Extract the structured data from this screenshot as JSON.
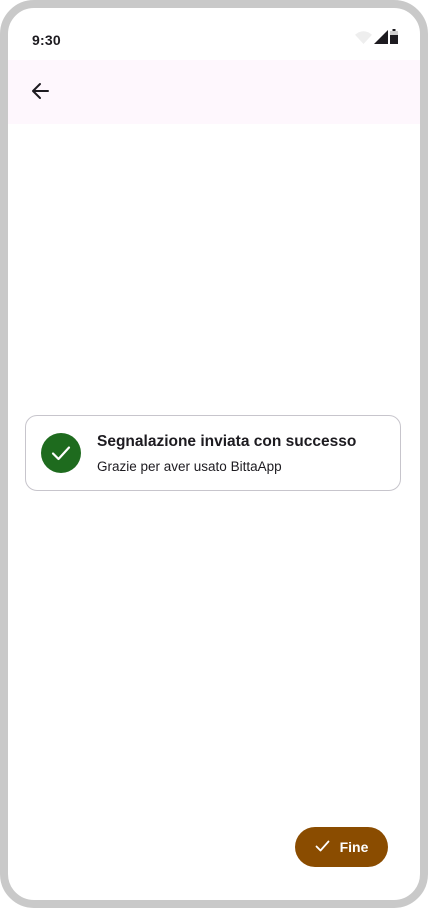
{
  "status_bar": {
    "time": "9:30",
    "icons": [
      "wifi-icon",
      "signal-icon",
      "battery-icon"
    ]
  },
  "app_bar": {
    "back_icon": "arrow-back-icon",
    "color": "#fef7fd"
  },
  "success_card": {
    "icon": "check-circle-icon",
    "title": "Segnalazione inviata con successo",
    "subtitle": "Grazie per aver usato BittaApp",
    "icon_color": "#1e6b1e"
  },
  "fab": {
    "icon": "check-icon",
    "label": "Fine",
    "color": "#8a4c00"
  }
}
